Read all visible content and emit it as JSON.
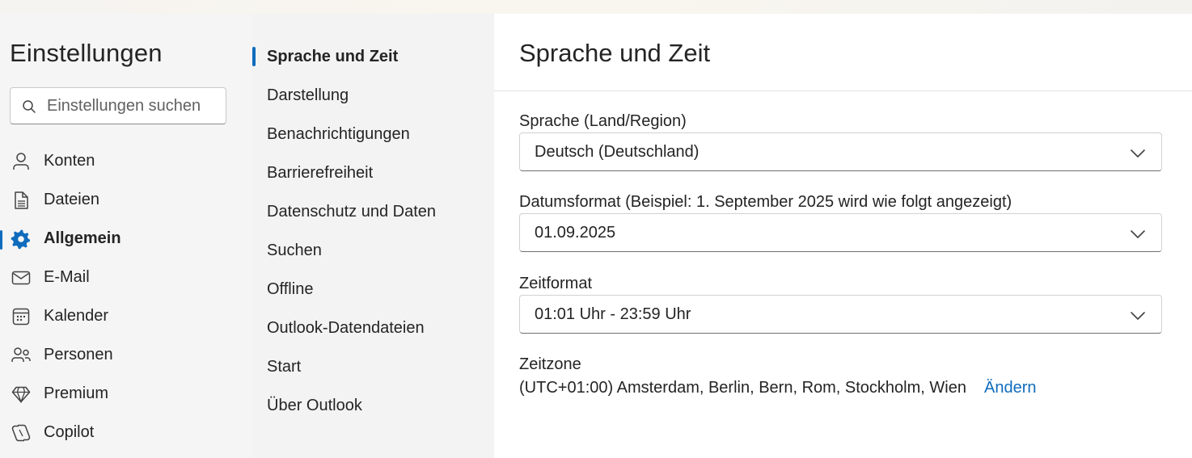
{
  "app": {
    "title": "Einstellungen"
  },
  "search": {
    "placeholder": "Einstellungen suchen",
    "value": ""
  },
  "nav": {
    "items": [
      {
        "label": "Konten",
        "icon": "person-icon",
        "active": false
      },
      {
        "label": "Dateien",
        "icon": "document-icon",
        "active": false
      },
      {
        "label": "Allgemein",
        "icon": "gear-icon",
        "active": true
      },
      {
        "label": "E-Mail",
        "icon": "mail-icon",
        "active": false
      },
      {
        "label": "Kalender",
        "icon": "calendar-icon",
        "active": false
      },
      {
        "label": "Personen",
        "icon": "people-icon",
        "active": false
      },
      {
        "label": "Premium",
        "icon": "diamond-icon",
        "active": false
      },
      {
        "label": "Copilot",
        "icon": "copilot-icon",
        "active": false
      }
    ]
  },
  "subnav": {
    "items": [
      {
        "label": "Sprache und Zeit",
        "active": true
      },
      {
        "label": "Darstellung",
        "active": false
      },
      {
        "label": "Benachrichtigungen",
        "active": false
      },
      {
        "label": "Barrierefreiheit",
        "active": false
      },
      {
        "label": "Datenschutz und Daten",
        "active": false
      },
      {
        "label": "Suchen",
        "active": false
      },
      {
        "label": "Offline",
        "active": false
      },
      {
        "label": "Outlook-Datendateien",
        "active": false
      },
      {
        "label": "Start",
        "active": false
      },
      {
        "label": "Über Outlook",
        "active": false
      }
    ]
  },
  "main": {
    "title": "Sprache und Zeit",
    "language": {
      "label": "Sprache (Land/Region)",
      "value": "Deutsch (Deutschland)"
    },
    "date_format": {
      "label": "Datumsformat (Beispiel: 1. September 2025 wird wie folgt angezeigt)",
      "value": "01.09.2025"
    },
    "time_format": {
      "label": "Zeitformat",
      "value": "01:01 Uhr - 23:59 Uhr"
    },
    "timezone": {
      "label": "Zeitzone",
      "value": "(UTC+01:00) Amsterdam, Berlin, Bern, Rom, Stockholm, Wien",
      "change_label": "Ändern"
    }
  },
  "colors": {
    "accent": "#0f6cbd",
    "text": "#242424",
    "pane_bg": "#f5f5f5"
  }
}
